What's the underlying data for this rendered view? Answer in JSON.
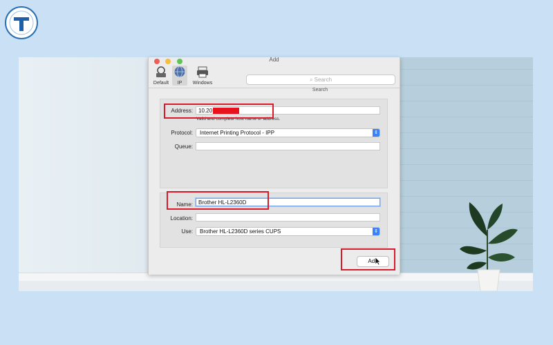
{
  "window": {
    "title": "Add"
  },
  "toolbar": {
    "default_label": "Default",
    "ip_label": "IP",
    "windows_label": "Windows",
    "search_placeholder": "Search",
    "search_label": "Search"
  },
  "form": {
    "address_label": "Address:",
    "address_value": "10.20",
    "address_hint": "Valid and complete host name or address.",
    "protocol_label": "Protocol:",
    "protocol_value": "Internet Printing Protocol - IPP",
    "queue_label": "Queue:",
    "queue_value": "",
    "name_label": "Name:",
    "name_value": "Brother HL-L2360D",
    "location_label": "Location:",
    "location_value": "",
    "use_label": "Use:",
    "use_value": "Brother HL-L2360D series CUPS"
  },
  "buttons": {
    "add_label": "Add"
  },
  "colors": {
    "highlight": "#d91a2a",
    "accent": "#3b82f6",
    "redaction": "#e8121c"
  },
  "icons": [
    "logo-badge",
    "default-printer-icon",
    "globe-icon",
    "windows-printer-icon",
    "search-icon",
    "chevron-updown-icon",
    "mouse-cursor-icon"
  ]
}
